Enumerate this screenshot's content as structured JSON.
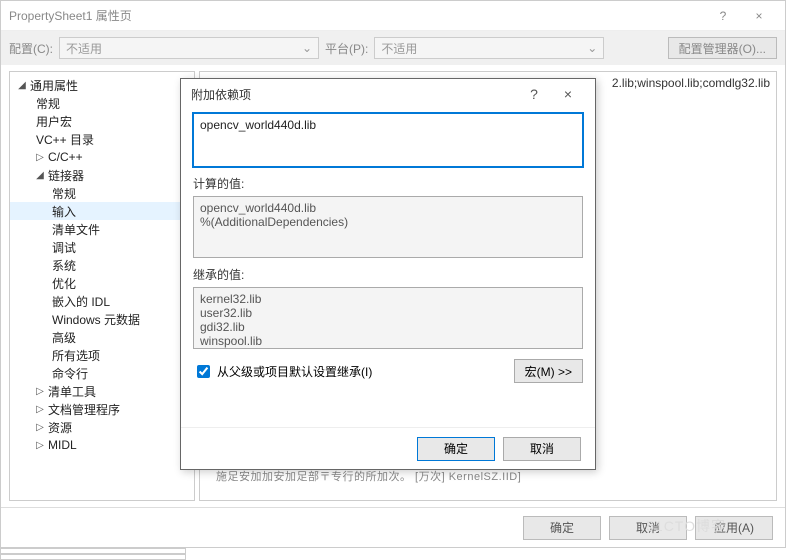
{
  "window": {
    "title": "PropertySheet1 属性页",
    "help": "?",
    "close": "×"
  },
  "toolbar": {
    "configLabel": "配置(C):",
    "configValue": "不适用",
    "platformLabel": "平台(P):",
    "platformValue": "不适用",
    "configMgr": "配置管理器(O)...",
    "chevron": "⌄"
  },
  "tree": {
    "root": "通用属性",
    "items1": [
      "常规",
      "用户宏",
      "VC++ 目录"
    ],
    "cc": "C/C++",
    "linker": "链接器",
    "linkerItems": [
      "常规",
      "输入",
      "清单文件",
      "调试",
      "系统",
      "优化",
      "嵌入的 IDL",
      "Windows 元数据",
      "高级",
      "所有选项",
      "命令行"
    ],
    "rest": [
      "清单工具",
      "文档管理程序",
      "资源",
      "MIDL"
    ]
  },
  "right": {
    "partialPath": "2.lib;winspool.lib;comdlg32.lib",
    "hint": "施足安加加安加足部〒专行的所加次。 [万次] KernelSZ.IID]"
  },
  "dialog": {
    "title": "附加依赖项",
    "help": "?",
    "close": "×",
    "mainValue": "opencv_world440d.lib",
    "calcLabel": "计算的值:",
    "calcValue": "opencv_world440d.lib\n%(AdditionalDependencies)",
    "inhLabel": "继承的值:",
    "inhValue": "kernel32.lib\nuser32.lib\ngdi32.lib\nwinspool.lib",
    "inheritCb": "从父级或项目默认设置继承(I)",
    "macroBtn": "宏(M) >>",
    "ok": "确定",
    "cancel": "取消"
  },
  "footer": {
    "ok": "确定",
    "cancel": "取消",
    "apply": "应用(A)"
  },
  "watermark": "51CTO博客"
}
